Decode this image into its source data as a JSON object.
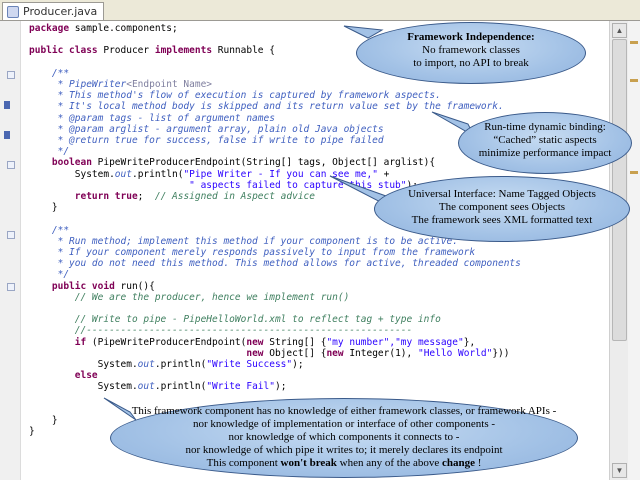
{
  "tab": {
    "title": "Producer.java"
  },
  "code_lines": [
    [
      {
        "c": "kw",
        "t": "package"
      },
      {
        "c": "",
        "t": " sample.components;"
      }
    ],
    [
      {
        "c": "",
        "t": ""
      }
    ],
    [
      {
        "c": "kw",
        "t": "public class"
      },
      {
        "c": "",
        "t": " Producer "
      },
      {
        "c": "kw",
        "t": "implements"
      },
      {
        "c": "",
        "t": " Runnable {"
      }
    ],
    [
      {
        "c": "",
        "t": ""
      }
    ],
    [
      {
        "c": "jd",
        "t": "    /**"
      }
    ],
    [
      {
        "c": "jd",
        "t": "     * PipeWriter"
      },
      {
        "c": "tg",
        "t": "<Endpoint Name>"
      }
    ],
    [
      {
        "c": "jd",
        "t": "     * This method's flow of execution is captured by framework aspects."
      }
    ],
    [
      {
        "c": "jd",
        "t": "     * It's local method body is skipped and its return value set by the framework."
      }
    ],
    [
      {
        "c": "jd",
        "t": "     * @param tags - list of argument names"
      }
    ],
    [
      {
        "c": "jd",
        "t": "     * @param arglist - argument array, plain old Java objects"
      }
    ],
    [
      {
        "c": "jd",
        "t": "     * @return true for success, false if write to pipe failed"
      }
    ],
    [
      {
        "c": "jd",
        "t": "     */"
      }
    ],
    [
      {
        "c": "kw",
        "t": "    boolean"
      },
      {
        "c": "",
        "t": " PipeWriteProducerEndpoint(String[] tags, Object[] arglist){"
      }
    ],
    [
      {
        "c": "",
        "t": "        System."
      },
      {
        "c": "jd",
        "t": "out"
      },
      {
        "c": "",
        "t": ".println("
      },
      {
        "c": "st",
        "t": "\"Pipe Writer - If you can see me,\""
      },
      {
        "c": "",
        "t": " +"
      }
    ],
    [
      {
        "c": "st",
        "t": "                            \" aspects failed to capture this stub\""
      },
      {
        "c": "",
        "t": ");"
      }
    ],
    [
      {
        "c": "kw",
        "t": "        return true"
      },
      {
        "c": "",
        "t": ";  "
      },
      {
        "c": "cm",
        "t": "// Assigned in Aspect advice"
      }
    ],
    [
      {
        "c": "",
        "t": "    }"
      }
    ],
    [
      {
        "c": "",
        "t": ""
      }
    ],
    [
      {
        "c": "jd",
        "t": "    /**"
      }
    ],
    [
      {
        "c": "jd",
        "t": "     * Run method; implement this method if your component is to be active."
      }
    ],
    [
      {
        "c": "jd",
        "t": "     * If your component merely responds passively to input from the framework"
      }
    ],
    [
      {
        "c": "jd",
        "t": "     * you do not need this method. This method allows for active, threaded components"
      }
    ],
    [
      {
        "c": "jd",
        "t": "     */"
      }
    ],
    [
      {
        "c": "kw",
        "t": "    public void"
      },
      {
        "c": "",
        "t": " run(){"
      }
    ],
    [
      {
        "c": "cm",
        "t": "        // We are the producer, hence we implement run()"
      }
    ],
    [
      {
        "c": "",
        "t": ""
      }
    ],
    [
      {
        "c": "cm",
        "t": "        // Write to pipe - PipeHelloWorld.xml to reflect tag + type info"
      }
    ],
    [
      {
        "c": "cm",
        "t": "        //---------------------------------------------------------"
      }
    ],
    [
      {
        "c": "kw",
        "t": "        if"
      },
      {
        "c": "",
        "t": " (PipeWriteProducerEndpoint("
      },
      {
        "c": "kw",
        "t": "new"
      },
      {
        "c": "",
        "t": " String[] {"
      },
      {
        "c": "st",
        "t": "\"my number\",\"my message\""
      },
      {
        "c": "",
        "t": "},"
      }
    ],
    [
      {
        "c": "",
        "t": "                                      "
      },
      {
        "c": "kw",
        "t": "new"
      },
      {
        "c": "",
        "t": " Object[] {"
      },
      {
        "c": "kw",
        "t": "new"
      },
      {
        "c": "",
        "t": " Integer(1), "
      },
      {
        "c": "st",
        "t": "\"Hello World\""
      },
      {
        "c": "",
        "t": "}))"
      }
    ],
    [
      {
        "c": "",
        "t": "            System."
      },
      {
        "c": "jd",
        "t": "out"
      },
      {
        "c": "",
        "t": ".println("
      },
      {
        "c": "st",
        "t": "\"Write Success\""
      },
      {
        "c": "",
        "t": ");"
      }
    ],
    [
      {
        "c": "kw",
        "t": "        else"
      }
    ],
    [
      {
        "c": "",
        "t": "            System."
      },
      {
        "c": "jd",
        "t": "out"
      },
      {
        "c": "",
        "t": ".println("
      },
      {
        "c": "st",
        "t": "\"Write Fail\""
      },
      {
        "c": "",
        "t": ");"
      }
    ],
    [
      {
        "c": "",
        "t": ""
      }
    ],
    [
      {
        "c": "",
        "t": ""
      }
    ],
    [
      {
        "c": "",
        "t": "    }"
      }
    ],
    [
      {
        "c": "",
        "t": "}"
      }
    ]
  ],
  "callouts": {
    "framework_independence": {
      "l1": "Framework Independence:",
      "l2": "No framework classes",
      "l3": "to import, no API to break"
    },
    "runtime_binding": {
      "l1": "Run-time dynamic binding:",
      "l2": "“Cached” static aspects",
      "l3": "minimize performance impact"
    },
    "universal_interface": {
      "l1": "Universal Interface: Name Tagged Objects",
      "l2": "The component sees Objects",
      "l3": "The framework sees XML formatted text"
    },
    "bottom": {
      "l1": "This framework component has no knowledge of either framework classes, or framework APIs -",
      "l2": "nor knowledge of implementation or interface of other components -",
      "l3": "nor knowledge of which components it connects to -",
      "l4": "nor knowledge of which pipe it writes to; it merely declares its endpoint",
      "l5a": "This component ",
      "l5b": "won't break",
      "l5c": " when any of the above ",
      "l5d": "change",
      "l5e": " !"
    }
  },
  "colors": {
    "keyword": "#7f0055",
    "comment": "#3f7f5f",
    "javadoc": "#3f5fbf",
    "string": "#2a00ff",
    "callout": "#a3c2e6"
  }
}
